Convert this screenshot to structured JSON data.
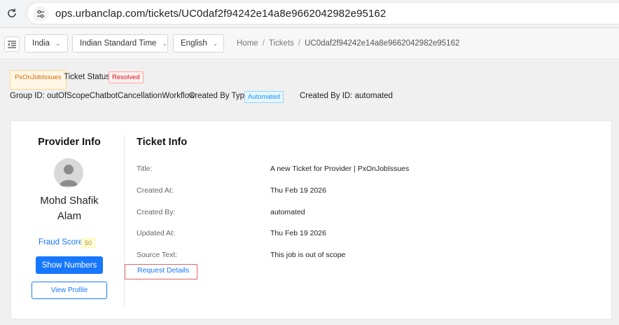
{
  "browser": {
    "url": "ops.urbanclap.com/tickets/UC0daf2f94242e14a8e9662042982e95162"
  },
  "toolbar": {
    "country": "India",
    "timezone": "Indian Standard Time",
    "language": "English"
  },
  "breadcrumb": {
    "home": "Home",
    "section": "Tickets",
    "current": "UC0daf2f94242e14a8e9662042982e95162"
  },
  "meta": {
    "category_tag": "PxOnJobIssues",
    "ticket_status_label": "Ticket Status:",
    "ticket_status": "Resolved",
    "group_id": "Group ID: outOfScopeChatbotCancellationWorkflow",
    "created_by_type_label": "Created By Type:",
    "created_by_type": "Automated",
    "created_by_id": "Created By ID: automated"
  },
  "provider": {
    "title": "Provider Info",
    "name_line1": "Mohd Shafik",
    "name_line2": "Alam",
    "fraud_label": "Fraud Score",
    "fraud_score": "50",
    "show_numbers": "Show Numbers",
    "view_profile": "View Profile"
  },
  "ticket": {
    "title": "Ticket Info",
    "rows": [
      {
        "label": "Title:",
        "value": "A new Ticket for Provider | PxOnJobIssues"
      },
      {
        "label": "Created At:",
        "value": "Thu Feb 19 2026"
      },
      {
        "label": "Created By:",
        "value": "automated"
      },
      {
        "label": "Updated At:",
        "value": "Thu Feb 19 2026"
      },
      {
        "label": "Source Text:",
        "value": "This job is out of scope"
      }
    ],
    "request_details": "Request Details"
  },
  "colors": {
    "primary": "#1677ff",
    "resolved": "#cf1322",
    "category": "#d46b08"
  }
}
